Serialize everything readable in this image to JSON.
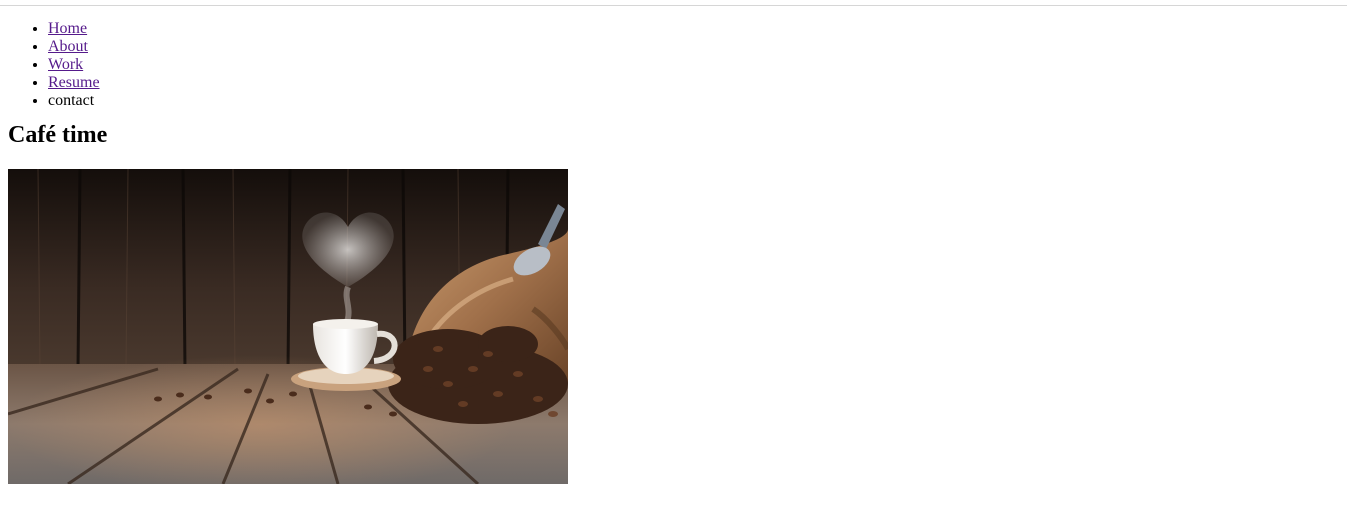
{
  "nav": {
    "items": [
      {
        "label": "Home",
        "link": true
      },
      {
        "label": "About",
        "link": true
      },
      {
        "label": "Work",
        "link": true
      },
      {
        "label": "Resume",
        "link": true
      },
      {
        "label": "contact",
        "link": false
      }
    ]
  },
  "main": {
    "title": "Café time"
  },
  "colors": {
    "visited_link": "#551a8b",
    "text": "#000000",
    "rule": "#d6d6d6"
  }
}
